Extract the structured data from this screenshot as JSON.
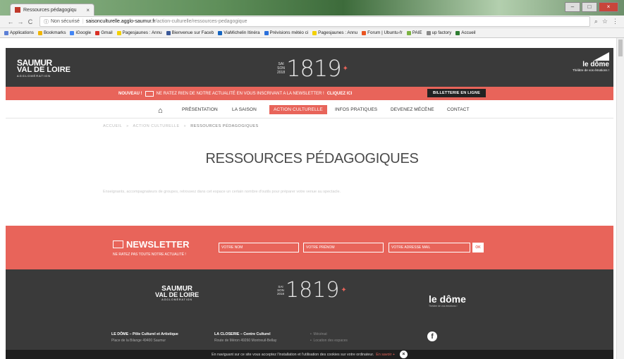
{
  "browser": {
    "tab_title": "Ressources pédagogiqu",
    "tab_close": "×",
    "window_buttons": [
      "–",
      "□",
      "×"
    ],
    "nav": {
      "back": "←",
      "forward": "→",
      "reload": "C"
    },
    "security_label": "Non sécurisé",
    "url_host": "saisonculturelle.agglo-saumur.fr",
    "url_path": "/action-culturelle/ressources-pedagogique",
    "omnibox_icons": [
      "zoom-icon",
      "star-icon",
      "menu-icon"
    ],
    "bookmarks": [
      {
        "label": "Applications",
        "color": "#5b7fd6"
      },
      {
        "label": "Bookmarks",
        "color": "#f0b400"
      },
      {
        "label": "iGoogle",
        "color": "#4285f4"
      },
      {
        "label": "Gmail",
        "color": "#d93025"
      },
      {
        "label": "Pagesjaunes : Annu",
        "color": "#f3d000"
      },
      {
        "label": "Bienvenue sur Faceb",
        "color": "#3b5998"
      },
      {
        "label": "ViaMichelin Itinéra",
        "color": "#1565c0"
      },
      {
        "label": "Prévisions météo ci",
        "color": "#2a6fdb"
      },
      {
        "label": "Pagesjaunes : Annu",
        "color": "#f3d000"
      },
      {
        "label": "Forum | Ubuntu-fr",
        "color": "#e95420"
      },
      {
        "label": "PAIE",
        "color": "#7cb342"
      },
      {
        "label": "up factory",
        "color": "#888888"
      },
      {
        "label": "Accueil",
        "color": "#2e7d32"
      }
    ]
  },
  "header": {
    "saumur_logo": {
      "line1": "SAUMUR",
      "line2": "VAL DE LOIRE",
      "line3": "AGGLOMÉRATION"
    },
    "season_logo": {
      "small": [
        "SAI",
        "SON",
        "2018"
      ],
      "big": "1819",
      "accent": "#e8645a"
    },
    "dome_logo": {
      "name": "le dôme",
      "tagline": "Théâtre de vos émotions !"
    }
  },
  "announcement": {
    "badge": "NOUVEAU !",
    "text": "NE RATEZ RIEN DE NOTRE ACTUALITÉ EN VOUS INSCRIVANT A LA NEWSLETTER !",
    "cta": "CLIQUEZ ICI",
    "ticketing_button": "BILLETTERIE EN LIGNE"
  },
  "main_nav": {
    "items": [
      "PRÉSENTATION",
      "LA SAISON",
      "ACTION CULTURELLE",
      "INFOS PRATIQUES",
      "DEVENEZ MÉCÈNE",
      "CONTACT"
    ],
    "active_index": 2
  },
  "breadcrumb": {
    "home": "ACCUEIL",
    "parent": "ACTION CULTURELLE",
    "separator": "»",
    "current": "RESSOURCES PÉDAGOGIQUES"
  },
  "page": {
    "title": "RESSOURCES PÉDAGOGIQUES",
    "intro": "Enseignants, accompagnateurs de groupes, retrouvez dans cet espace un certain nombre d'outils pour préparer votre venue au spectacle."
  },
  "newsletter": {
    "title": "NEWSLETTER",
    "subtitle": "NE RATEZ PAS TOUTE NOTRE ACTUALITÉ !",
    "name_placeholder": "VOTRE NOM",
    "firstname_placeholder": "VOTRE PRÉNOM",
    "email_placeholder": "VOTRE ADRESSE MAIL",
    "submit": "OK"
  },
  "footer": {
    "col1": {
      "title": "LE DÔME – Pôle Culturel et Artistique",
      "address": "Place de la Bilange 49400 Saumur"
    },
    "col2": {
      "title": "LA CLOSERIE – Centre Culturel",
      "address": "Route de Méron 49260 Montreuil-Bellay"
    },
    "links": [
      "Mécénat",
      "Location des espaces"
    ],
    "social": "f"
  },
  "cookie": {
    "text": "En naviguant sur ce site vous acceptez l'installation et l'utilisation des cookies sur votre ordinateur.",
    "link": "En savoir +",
    "close": "×"
  }
}
